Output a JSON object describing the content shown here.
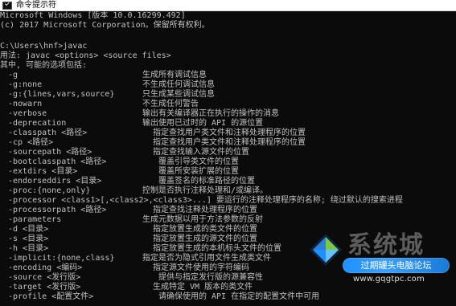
{
  "window": {
    "title": "命令提示符",
    "icon": "cmd-icon"
  },
  "console": {
    "header_line_1": "Microsoft Windows [版本 10.0.16299.492]",
    "header_line_2": "(c) 2017 Microsoft Corporation。保留所有权利。",
    "prompt_line": "C:\\Users\\hnf>javac",
    "usage_line": "用法: javac <options> <source files>",
    "options_heading": "其中, 可能的选项包括:",
    "options": [
      {
        "flag": "-g",
        "desc": "生成所有调试信息"
      },
      {
        "flag": "-g:none",
        "desc": "不生成任何调试信息"
      },
      {
        "flag": "-g:{lines,vars,source}",
        "desc": "只生成某些调试信息"
      },
      {
        "flag": "-nowarn",
        "desc": "不生成任何警告"
      },
      {
        "flag": "-verbose",
        "desc": "输出有关编译器正在执行的操作的消息"
      },
      {
        "flag": "-deprecation",
        "desc": "输出使用已过时的 API 的源位置"
      },
      {
        "flag": "-classpath <路径>",
        "desc": "指定查找用户类文件和注释处理程序的位置"
      },
      {
        "flag": "-cp <路径>",
        "desc": "指定查找用户类文件和注释处理程序的位置"
      },
      {
        "flag": "-sourcepath <路径>",
        "desc": "指定查找输入源文件的位置"
      },
      {
        "flag": "-bootclasspath <路径>",
        "desc": "覆盖引导类文件的位置"
      },
      {
        "flag": "-extdirs <目录>",
        "desc": "覆盖所安装扩展的位置"
      },
      {
        "flag": "-endorseddirs <目录>",
        "desc": "覆盖签名的标准路径的位置"
      },
      {
        "flag": "-proc:{none,only}",
        "desc": "控制是否执行注释处理和/或编译。"
      },
      {
        "flag": "-processor <class1>[,<class2>,<class3>...] 要运行的注释处理程序的名称; 绕过默认的搜索进程",
        "desc": ""
      },
      {
        "flag": "-processorpath <路径>",
        "desc": "指定查找注释处理程序的位置"
      },
      {
        "flag": "-parameters",
        "desc": "生成元数据以用于方法参数的反射"
      },
      {
        "flag": "-d <目录>",
        "desc": "指定放置生成的类文件的位置"
      },
      {
        "flag": "-s <目录>",
        "desc": "指定放置生成的源文件的位置"
      },
      {
        "flag": "-h <目录>",
        "desc": "指定放置生成的本机标头文件的位置"
      },
      {
        "flag": "-implicit:{none,class}",
        "desc": "指定是否为隐式引用文件生成类文件"
      },
      {
        "flag": "-encoding <编码>",
        "desc": "指定源文件使用的字符编码"
      },
      {
        "flag": "-source <发行版>",
        "desc": "提供与指定发行版的源兼容性"
      },
      {
        "flag": "-target <发行版>",
        "desc": "生成特定 VM 版本的类文件"
      },
      {
        "flag": "-profile <配置文件>",
        "desc": "请确保使用的 API 在指定的配置文件中可用"
      }
    ]
  },
  "watermark": {
    "brand": "系统城",
    "banner": "过期罐头电脑论坛",
    "url": "www.gqgtpc.com",
    "logo_colors": {
      "top_left": "#2f7fd6",
      "top_right": "#7ac943",
      "bottom_left": "#1e90ff",
      "bottom_right": "#66c2ff"
    }
  }
}
